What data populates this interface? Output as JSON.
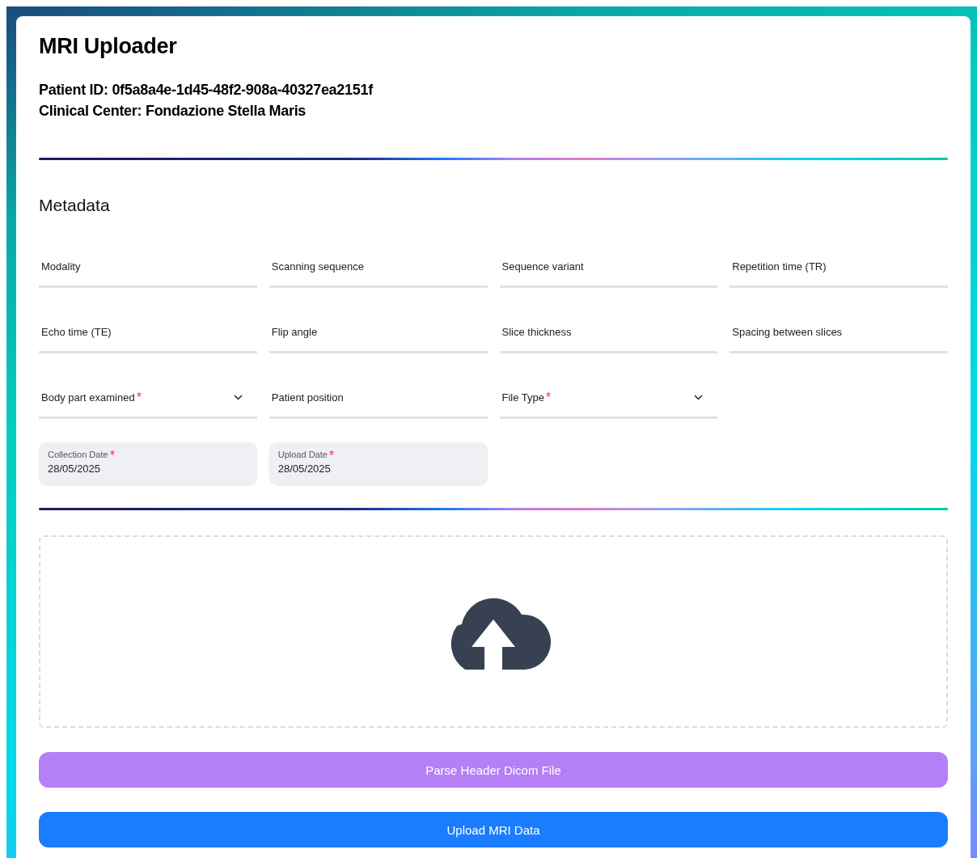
{
  "title": "MRI Uploader",
  "info": [
    "Patient ID: 0f5a8a4e-1d45-48f2-908a-40327ea2151f",
    "Clinical Center: Fondazione Stella Maris"
  ],
  "section_title": "Metadata",
  "fields": [
    {
      "kind": "text",
      "label": "Modality",
      "required": false
    },
    {
      "kind": "text",
      "label": "Scanning sequence",
      "required": false
    },
    {
      "kind": "text",
      "label": "Sequence variant",
      "required": false
    },
    {
      "kind": "text",
      "label": "Repetition time (TR)",
      "required": false
    },
    {
      "kind": "text",
      "label": "Echo time (TE)",
      "required": false
    },
    {
      "kind": "text",
      "label": "Flip angle",
      "required": false
    },
    {
      "kind": "text",
      "label": "Slice thickness",
      "required": false
    },
    {
      "kind": "text",
      "label": "Spacing between slices",
      "required": false
    },
    {
      "kind": "select",
      "label": "Body part examined",
      "required": true
    },
    {
      "kind": "text",
      "label": "Patient position",
      "required": false
    },
    {
      "kind": "select",
      "label": "File Type",
      "required": true
    },
    {
      "kind": "spacer"
    },
    {
      "kind": "date",
      "label": "Collection Date",
      "required": true,
      "value": "28/05/2025"
    },
    {
      "kind": "date",
      "label": "Upload Date",
      "required": true,
      "value": "28/05/2025"
    }
  ],
  "buttons": [
    {
      "kind": "secondary",
      "label": "Parse Header Dicom File"
    },
    {
      "kind": "primary",
      "label": "Upload MRI Data"
    }
  ]
}
